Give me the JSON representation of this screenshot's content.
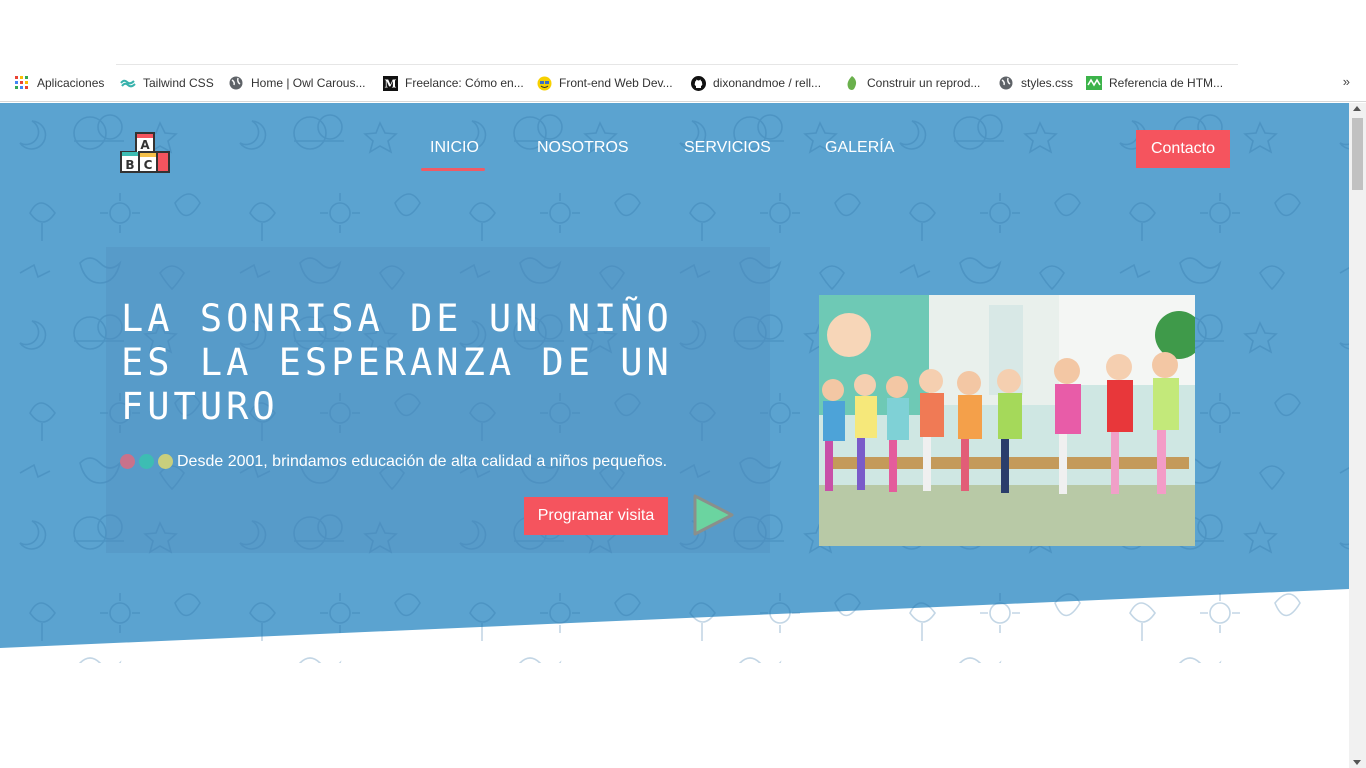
{
  "bookmarks": [
    {
      "label": "Aplicaciones",
      "icon": "apps-grid-icon"
    },
    {
      "label": "Tailwind CSS",
      "icon": "tailwind-icon"
    },
    {
      "label": "Home | Owl Carous...",
      "icon": "globe-icon"
    },
    {
      "label": "Freelance: Cómo en...",
      "icon": "medium-icon"
    },
    {
      "label": "Front-end Web Dev...",
      "icon": "face-icon"
    },
    {
      "label": "dixonandmoe / rell...",
      "icon": "github-icon"
    },
    {
      "label": "Construir un reprod...",
      "icon": "leaf-icon"
    },
    {
      "label": "styles.css",
      "icon": "globe-icon"
    },
    {
      "label": "Referencia de HTM...",
      "icon": "mdn-icon"
    }
  ],
  "bookmarks_more": "»",
  "site": {
    "logo": {
      "letters": [
        "A",
        "B",
        "C"
      ]
    },
    "nav": {
      "inicio": "INICIO",
      "nosotros": "NOSOTROS",
      "servicios": "SERVICIOS",
      "galeria": "GALERÍA"
    },
    "contact_label": "Contacto",
    "hero": {
      "headline": "LA SONRISA DE UN NIÑO ES LA ESPERANZA DE UN FUTURO",
      "subline": "Desde 2001, brindamos educación de alta calidad a niños pequeños.",
      "visit_label": "Programar visita",
      "dot_colors": [
        "#c9728b",
        "#3dbdb3",
        "#c9cf7d"
      ]
    }
  },
  "colors": {
    "hero_bg": "#5ba3d0",
    "accent": "#f5545e",
    "underline": "#ef5b65",
    "play": "#6bd4a0"
  }
}
